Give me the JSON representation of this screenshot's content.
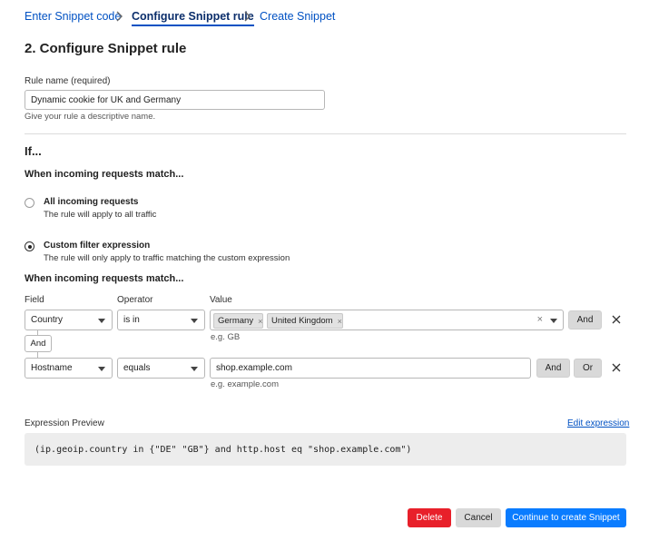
{
  "breadcrumb": {
    "step1": "Enter Snippet code",
    "step2": "Configure Snippet rule",
    "step3": "Create Snippet"
  },
  "page_title": "2. Configure Snippet rule",
  "rule_name": {
    "label": "Rule name (required)",
    "value": "Dynamic cookie for UK and Germany",
    "help": "Give your rule a descriptive name."
  },
  "if_section": {
    "heading": "If...",
    "match_heading": "When incoming requests match...",
    "options": [
      {
        "title": "All incoming requests",
        "description": "The rule will apply to all traffic",
        "checked": false
      },
      {
        "title": "Custom filter expression",
        "description": "The rule will only apply to traffic matching the custom expression",
        "checked": true
      }
    ],
    "match_heading_2": "When incoming requests match..."
  },
  "builder": {
    "field_header": "Field",
    "operator_header": "Operator",
    "value_header": "Value",
    "rows": [
      {
        "field": "Country",
        "operator": "is in",
        "tags": [
          "Germany",
          "United Kingdom"
        ],
        "example": "e.g. GB",
        "and_label": "And"
      },
      {
        "field": "Hostname",
        "operator": "equals",
        "value": "shop.example.com",
        "example": "e.g. example.com",
        "and_label": "And",
        "or_label": "Or"
      }
    ],
    "connector_label": "And"
  },
  "expression": {
    "label": "Expression Preview",
    "edit_link": "Edit expression",
    "code": "(ip.geoip.country in {\"DE\" \"GB\"} and http.host eq \"shop.example.com\")"
  },
  "actions": {
    "delete": "Delete",
    "cancel": "Cancel",
    "continue": "Continue to create Snippet"
  },
  "colors": {
    "link": "#0051c3",
    "primary": "#0a7cff",
    "danger": "#e8202a",
    "neutral_button": "#d9d9d9"
  }
}
